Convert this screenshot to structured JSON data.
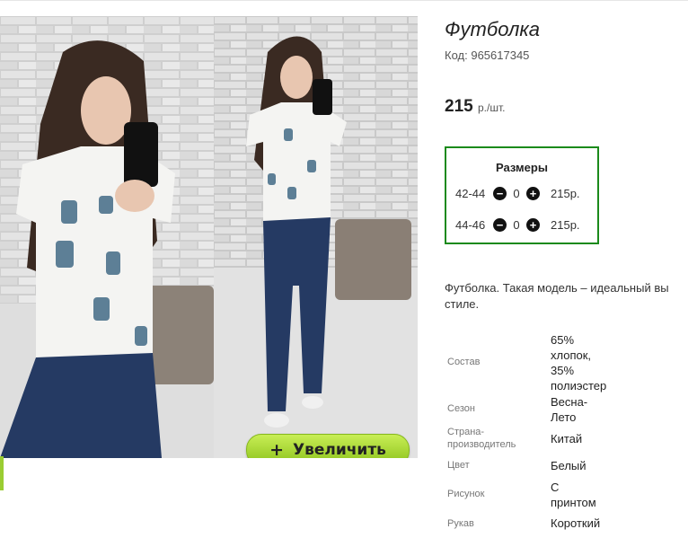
{
  "product": {
    "title": "Футболка",
    "code_label": "Код:",
    "code": "965617345",
    "price": "215",
    "price_unit": "р./шт."
  },
  "zoom_button": {
    "icon": "plus-icon",
    "label": "Увеличить"
  },
  "sizes": {
    "title": "Размеры",
    "rows": [
      {
        "size": "42-44",
        "qty": "0",
        "price": "215р."
      },
      {
        "size": "44-46",
        "qty": "0",
        "price": "215р."
      }
    ]
  },
  "description": {
    "line1": "Футболка. Такая модель – идеальный вы",
    "line2": "стиле."
  },
  "properties": [
    {
      "key": "Состав",
      "value_lines": [
        "65%",
        "хлопок,",
        "35%",
        "полиэстер"
      ]
    },
    {
      "key": "Сезон",
      "value_lines": [
        "Весна-",
        "Лето"
      ]
    },
    {
      "key_lines": [
        "Страна-",
        "производитель"
      ],
      "value_lines": [
        "Китай"
      ]
    },
    {
      "key": "Цвет",
      "value_lines": [
        "Белый"
      ]
    },
    {
      "key": "Рисунок",
      "value_lines": [
        "С",
        "принтом"
      ]
    },
    {
      "key": "Рукав",
      "value_lines": [
        "Короткий"
      ]
    }
  ],
  "colors": {
    "accent_green": "#8cc21c",
    "box_border": "#1b8a1b"
  }
}
